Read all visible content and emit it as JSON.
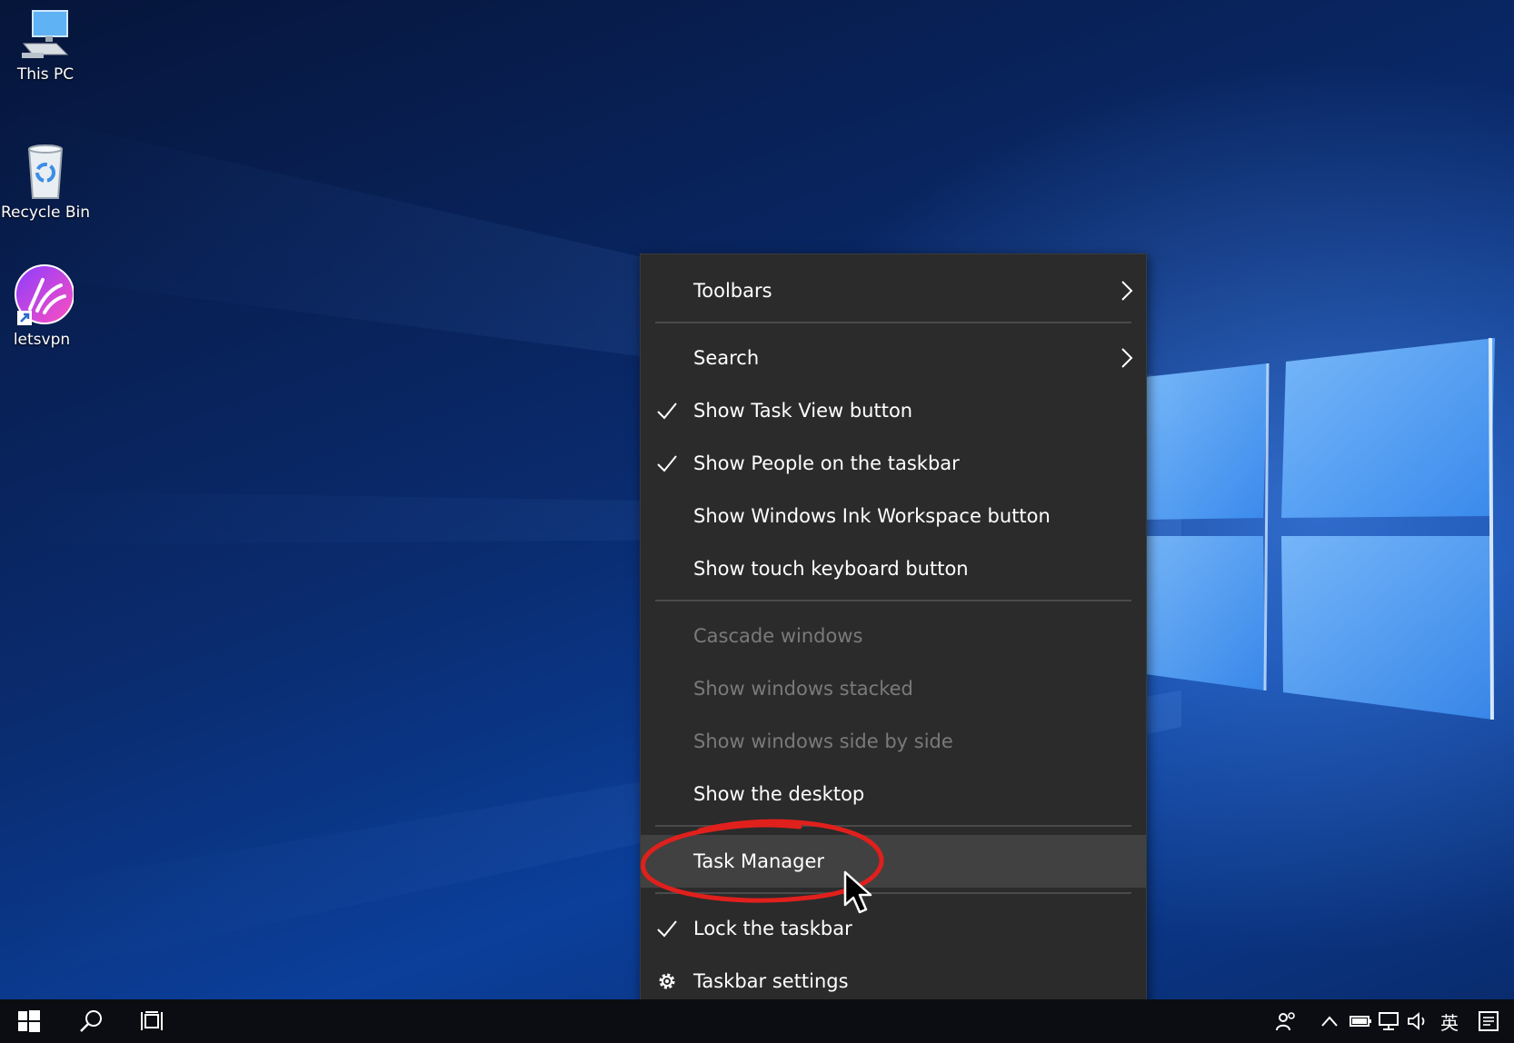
{
  "desktop": {
    "icons": [
      {
        "label": "This PC",
        "icon": "computer-icon"
      },
      {
        "label": "Recycle Bin",
        "icon": "recycle-bin-icon"
      },
      {
        "label": "letsvpn",
        "icon": "letsvpn-app-icon"
      }
    ]
  },
  "context_menu": {
    "items": [
      {
        "label": "Toolbars",
        "submenu": true
      },
      {
        "label": "Search",
        "submenu": true
      },
      {
        "label": "Show Task View button",
        "checked": true
      },
      {
        "label": "Show People on the taskbar",
        "checked": true
      },
      {
        "label": "Show Windows Ink Workspace button",
        "checked": false
      },
      {
        "label": "Show touch keyboard button",
        "checked": false
      },
      {
        "label": "Cascade windows",
        "disabled": true
      },
      {
        "label": "Show windows stacked",
        "disabled": true
      },
      {
        "label": "Show windows side by side",
        "disabled": true
      },
      {
        "label": "Show the desktop"
      },
      {
        "label": "Task Manager",
        "highlighted": true
      },
      {
        "label": "Lock the taskbar",
        "checked": true
      },
      {
        "label": "Taskbar settings",
        "icon": "gear-icon"
      }
    ]
  },
  "taskbar": {
    "start": "windows-start-icon",
    "search": "search-icon",
    "task_view": "task-view-icon",
    "tray": {
      "people": "people-icon",
      "chevron": "chevron-up-icon",
      "battery": "battery-icon",
      "network": "network-icon",
      "volume": "volume-icon",
      "ime_label": "英",
      "notifications": "notification-icon"
    }
  },
  "colors": {
    "menu_bg": "#2b2b2b",
    "menu_highlight": "#414141",
    "annotation": "#e0201c",
    "taskbar_bg": "#0b0d12"
  }
}
